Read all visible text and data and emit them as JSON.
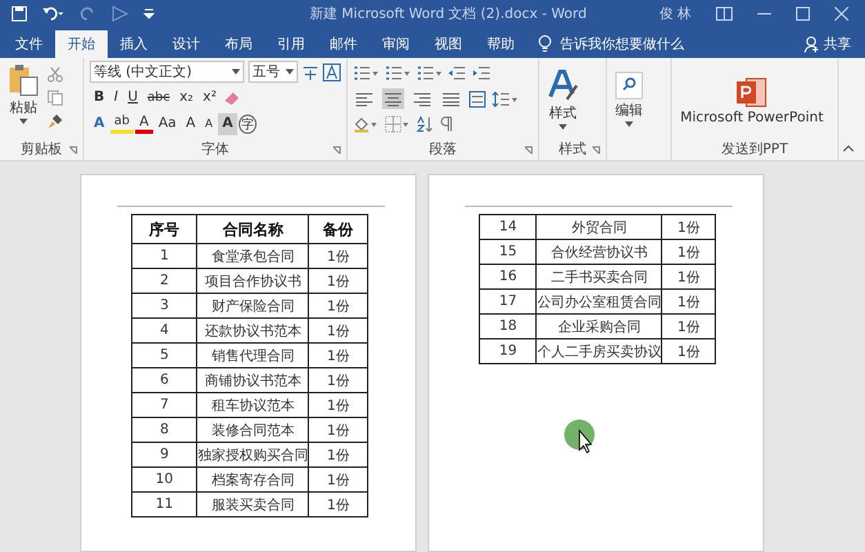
{
  "window": {
    "title": "新建 Microsoft Word 文档 (2).docx  -  Word",
    "user": "俊 林"
  },
  "tabs": [
    {
      "label": "文件",
      "selected": false
    },
    {
      "label": "开始",
      "selected": true
    },
    {
      "label": "插入",
      "selected": false
    },
    {
      "label": "设计",
      "selected": false
    },
    {
      "label": "布局",
      "selected": false
    },
    {
      "label": "引用",
      "selected": false
    },
    {
      "label": "邮件",
      "selected": false
    },
    {
      "label": "审阅",
      "selected": false
    },
    {
      "label": "视图",
      "selected": false
    },
    {
      "label": "帮助",
      "selected": false
    }
  ],
  "tell_me": "告诉我你想要做什么",
  "share": "共享",
  "clipboard": {
    "label": "剪贴板",
    "paste": "粘贴"
  },
  "font": {
    "label": "字体",
    "family": "等线 (中文正文)",
    "size": "五号",
    "format_buttons": [
      "B",
      "I",
      "U",
      "abc",
      "x₂",
      "x²"
    ],
    "color_buttons": [
      "A",
      "ab",
      "A",
      "Aa",
      "A",
      "A",
      "A",
      "字"
    ]
  },
  "paragraph": {
    "label": "段落",
    "align": [
      {
        "selected": false
      },
      {
        "selected": true
      },
      {
        "selected": false
      },
      {
        "selected": false
      }
    ]
  },
  "styles": {
    "label": "样式",
    "button": "样式"
  },
  "editing": {
    "button": "编辑"
  },
  "ppt": {
    "label": "发送到PPT",
    "button": "Microsoft PowerPoint"
  },
  "document": {
    "pages": [
      {
        "columns": [
          "序号",
          "合同名称",
          "备份"
        ],
        "rows": [
          {
            "no": "1",
            "name": "食堂承包合同",
            "copies": "1份"
          },
          {
            "no": "2",
            "name": "项目合作协议书",
            "copies": "1份"
          },
          {
            "no": "3",
            "name": "财产保险合同",
            "copies": "1份"
          },
          {
            "no": "4",
            "name": "还款协议书范本",
            "copies": "1份"
          },
          {
            "no": "5",
            "name": "销售代理合同",
            "copies": "1份"
          },
          {
            "no": "6",
            "name": "商铺协议书范本",
            "copies": "1份"
          },
          {
            "no": "7",
            "name": "租车协议范本",
            "copies": "1份"
          },
          {
            "no": "8",
            "name": "装修合同范本",
            "copies": "1份"
          },
          {
            "no": "9",
            "name": "独家授权购买合同",
            "copies": "1份"
          },
          {
            "no": "10",
            "name": "档案寄存合同",
            "copies": "1份"
          },
          {
            "no": "11",
            "name": "服装买卖合同",
            "copies": "1份"
          }
        ]
      },
      {
        "rows": [
          {
            "no": "14",
            "name": "外贸合同",
            "copies": "1份"
          },
          {
            "no": "15",
            "name": "合伙经营协议书",
            "copies": "1份"
          },
          {
            "no": "16",
            "name": "二手书买卖合同",
            "copies": "1份"
          },
          {
            "no": "17",
            "name": "公司办公室租赁合同",
            "copies": "1份"
          },
          {
            "no": "18",
            "name": "企业采购合同",
            "copies": "1份"
          },
          {
            "no": "19",
            "name": "个人二手房买卖协议",
            "copies": "1份"
          }
        ]
      }
    ]
  }
}
